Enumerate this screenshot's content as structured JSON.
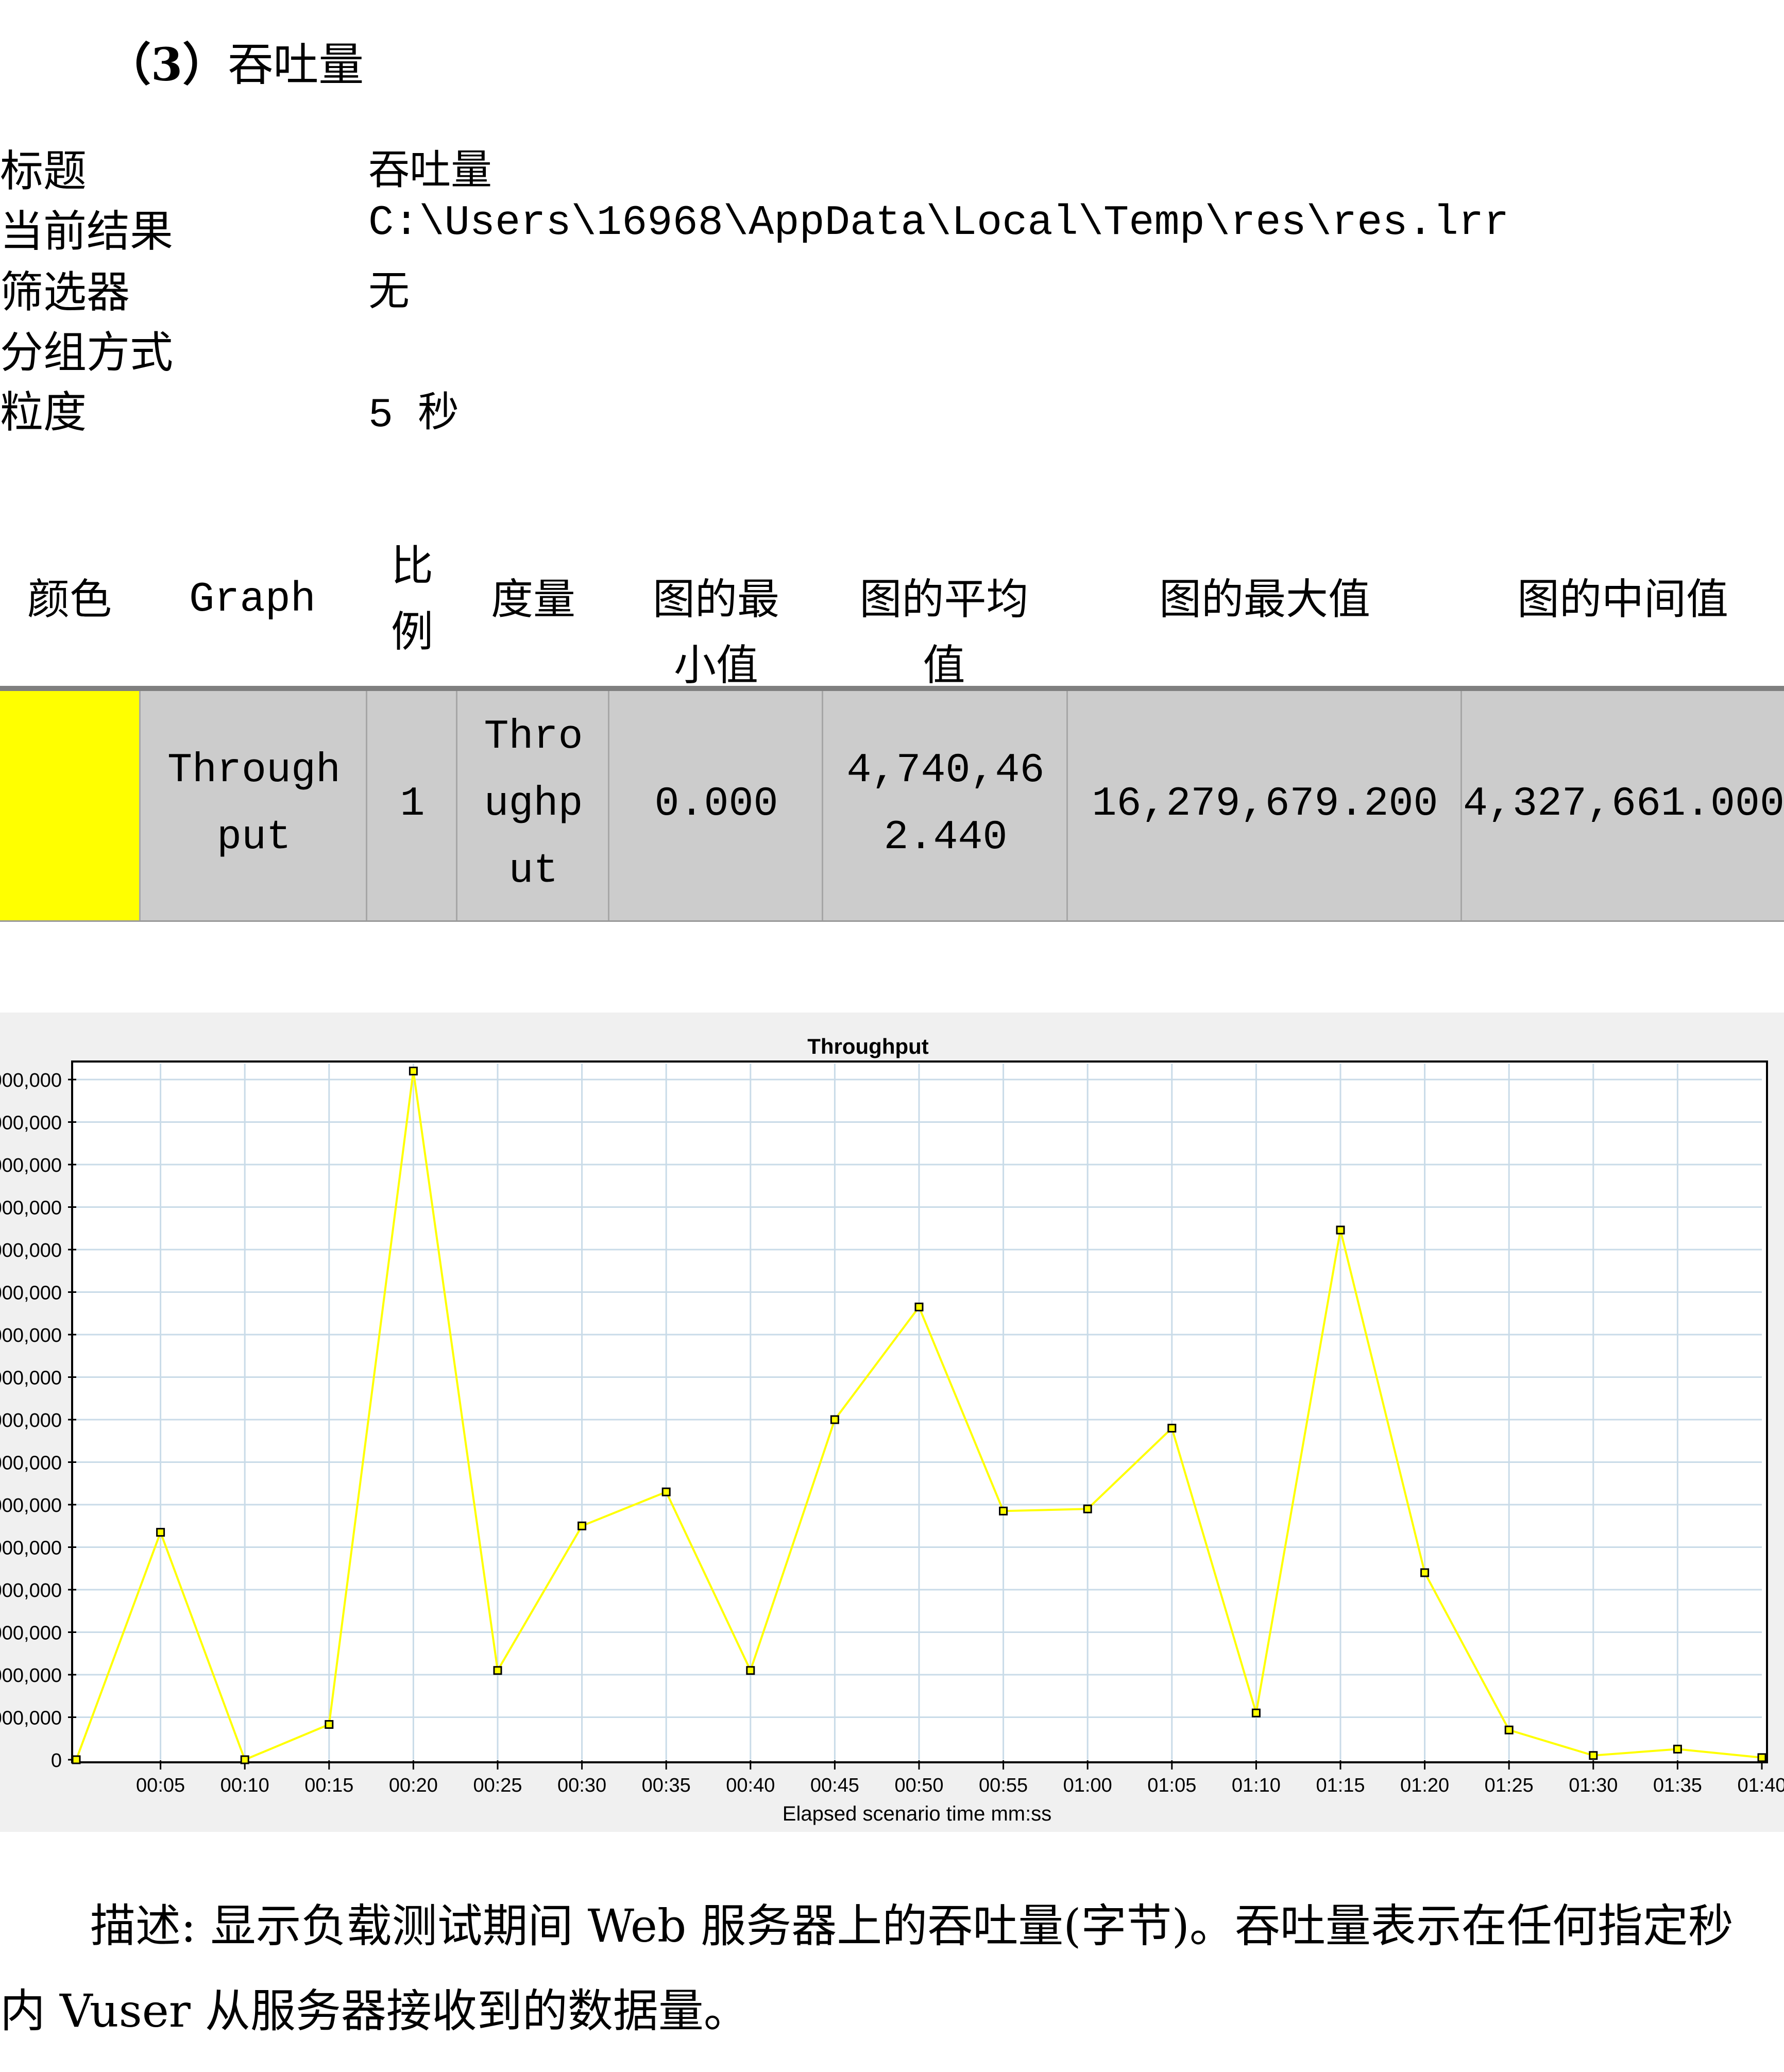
{
  "section_heading": {
    "number": "（3）",
    "title": "吞吐量"
  },
  "meta": [
    {
      "label": "标题",
      "value": "吞吐量"
    },
    {
      "label": "当前结果",
      "value": "C:\\Users\\16968\\AppData\\Local\\Temp\\res\\res.lrr"
    },
    {
      "label": "筛选器",
      "value": "无"
    },
    {
      "label": "分组方式",
      "value": ""
    },
    {
      "label": "粒度",
      "value": "5 秒"
    }
  ],
  "legend_table": {
    "headers": {
      "color": "颜色",
      "graph": "Graph",
      "scale_1": "比",
      "scale_2": "例",
      "measure": "度量",
      "min_1": "图的最",
      "min_2": "小值",
      "avg_1": "图的平均",
      "avg_2": "值",
      "max": "图的最大值",
      "median": "图的中间值"
    },
    "row": {
      "color": "#ffff00",
      "graph_1": "Through",
      "graph_2": "put",
      "scale": "1",
      "measure_1": "Thro",
      "measure_2": "ughp",
      "measure_3": "ut",
      "min": "0.000",
      "avg_1": "4,740,46",
      "avg_2": "2.440",
      "max": "16,279,679.200",
      "median": "4,327,661.000"
    }
  },
  "chart_data": {
    "type": "line",
    "title": "Throughput",
    "xlabel": "Elapsed scenario time mm:ss",
    "ylabel": "",
    "x": [
      "00:00",
      "00:05",
      "00:10",
      "00:15",
      "00:20",
      "00:25",
      "00:30",
      "00:35",
      "00:40",
      "00:45",
      "00:50",
      "00:55",
      "01:00",
      "01:05",
      "01:10",
      "01:15",
      "01:20",
      "01:25",
      "01:30",
      "01:35",
      "01:40"
    ],
    "x_tick_labels": [
      "00:05",
      "00:10",
      "00:15",
      "00:20",
      "00:25",
      "00:30",
      "00:35",
      "00:40",
      "00:45",
      "00:50",
      "00:55",
      "01:00",
      "01:05",
      "01:10",
      "01:15",
      "01:20",
      "01:25",
      "01:30",
      "01:35",
      "01:40"
    ],
    "y_tick_labels": [
      "0",
      "000,000",
      "000,000",
      "000,000",
      "000,000",
      "000,000",
      "000,000",
      "000,000",
      "000,000",
      "000,000",
      "000,000",
      "000,000",
      "000,000",
      "000,000",
      "000,000",
      "000,000",
      "000,000"
    ],
    "ylim": [
      0,
      16000000
    ],
    "grid": true,
    "series": [
      {
        "color": "#ffff00",
        "values": [
          0,
          5350000,
          0,
          830000,
          16200000,
          2100000,
          5500000,
          6300000,
          2100000,
          8000000,
          10650000,
          5850000,
          5900000,
          7800000,
          1100000,
          12460000,
          4400000,
          700000,
          100000,
          250000,
          50000
        ]
      }
    ]
  },
  "description": {
    "line1": "描述: 显示负载测试期间 Web 服务器上的吞吐量(字节)。吞吐量表示在任何指定秒",
    "line2": "内 Vuser 从服务器接收到的数据量。"
  }
}
